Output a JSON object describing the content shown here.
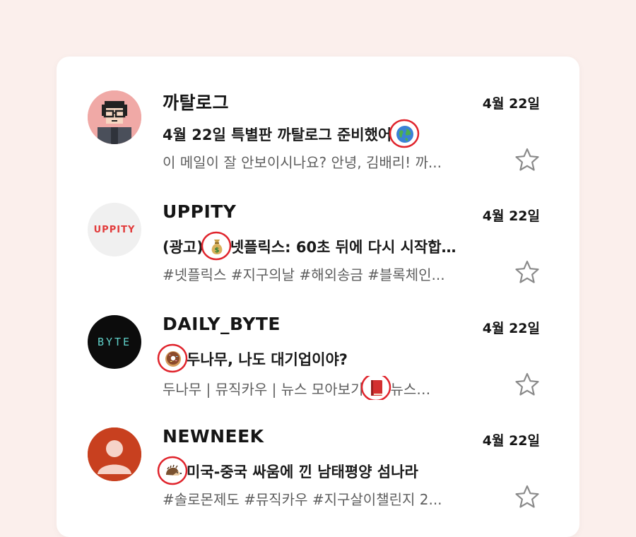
{
  "emails": [
    {
      "sender": "까탈로그",
      "date": "4월 22일",
      "subject_before": "4월 22일 특별판 까탈로그 준비했어",
      "subject_after": "",
      "preview_before": "이 메일이 잘 안보이시나요? 안녕, 김배리! 까...",
      "preview_after": "",
      "subject_emoji": "globe-icon",
      "avatar": "pixel-character-avatar"
    },
    {
      "sender": "UPPITY",
      "date": "4월 22일",
      "subject_before": "(광고)",
      "subject_after": "넷플릭스: 60초 뒤에 다시 시작합…",
      "preview_before": "#넷플릭스 #지구의날 #해외송금 #블록체인...",
      "preview_after": "",
      "subject_emoji": "money-bag-icon",
      "avatar_text": "UPPITY",
      "avatar_color": "#e23b3b"
    },
    {
      "sender": "DAILY_BYTE",
      "date": "4월 22일",
      "subject_before": "",
      "subject_after": "두나무, 나도 대기업이야?",
      "preview_before": "두나무 | 뮤직카우 | 뉴스 모아보기",
      "preview_after": "뉴스…",
      "subject_emoji": "donut-icon",
      "preview_emoji": "red-book-icon",
      "avatar_text": "BYTE",
      "avatar_color": "#5fd0c9"
    },
    {
      "sender": "NEWNEEK",
      "date": "4월 22일",
      "subject_before": "",
      "subject_after": "미국-중국 싸움에 낀 남태평양 섬나라",
      "preview_before": "#솔로몬제도 #뮤직카우 #지구살이챌린지 2...",
      "preview_after": "",
      "subject_emoji": "hedgehog-icon",
      "avatar": "person-silhouette-avatar",
      "avatar_color": "#c8401f"
    }
  ],
  "colors": {
    "page_background": "#fbefec",
    "card_background": "#ffffff",
    "highlight_ring": "#e0242c",
    "star_outline": "#8a8a8a"
  }
}
